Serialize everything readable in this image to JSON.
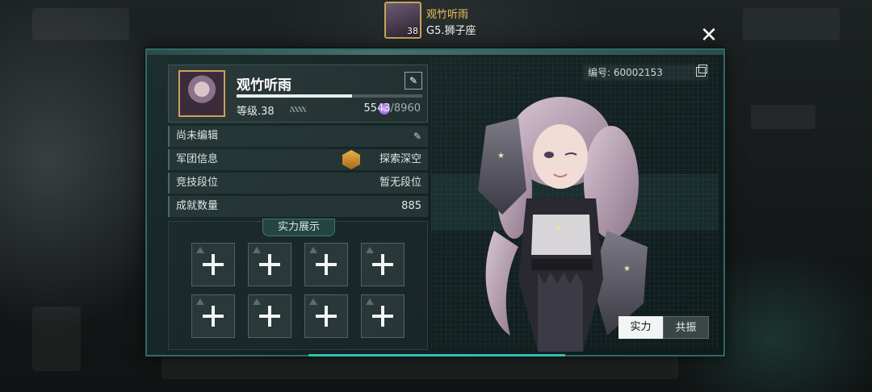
{
  "header": {
    "player_name": "观竹听雨",
    "player_level": "38",
    "player_subtitle": "G5.狮子座"
  },
  "profile": {
    "name": "观竹听雨",
    "level_label": "等级.38",
    "xp_current": "5543",
    "xp_max": "/8960",
    "xp_fraction": 0.62,
    "player_id": "编号: 60002153"
  },
  "info_rows": [
    {
      "label": "尚未编辑",
      "value": ""
    },
    {
      "label": "军团信息",
      "value": "探索深空"
    },
    {
      "label": "竞技段位",
      "value": "暂无段位"
    },
    {
      "label": "成就数量",
      "value": "885"
    }
  ],
  "showcase": {
    "title": "实力展示"
  },
  "toggle": {
    "strength_label": "实力",
    "resonance_label": "共振"
  },
  "colors": {
    "accent": "#2ec0b3",
    "gold": "#f0c15a"
  }
}
